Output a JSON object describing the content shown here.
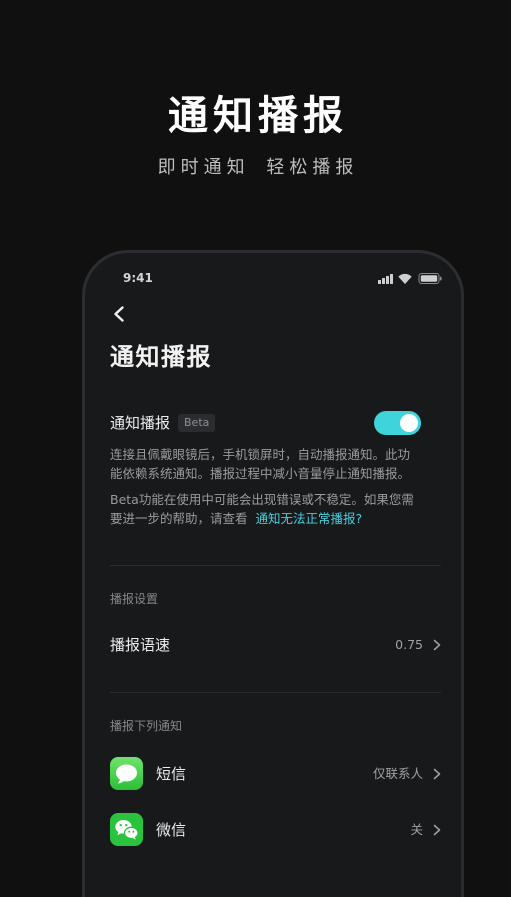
{
  "hero": {
    "title": "通知播报",
    "subtitle": "即时通知 轻松播报"
  },
  "status_bar": {
    "time": "9:41",
    "icons": [
      "cellular-signal-icon",
      "wifi-icon",
      "battery-icon"
    ]
  },
  "screen": {
    "back_icon": "chevron-left-icon",
    "title": "通知播报",
    "feature": {
      "label": "通知播报",
      "badge": "Beta",
      "enabled": true,
      "description": "连接且佩戴眼镜后，手机锁屏时，自动播报通知。此功能依赖系统通知。播报过程中减小音量停止通知播报。",
      "note": "Beta功能在使用中可能会出现错误或不稳定。如果您需要进一步的帮助，请查看",
      "help_link": "通知无法正常播报?"
    },
    "sections": [
      {
        "header": "播报设置",
        "items": [
          {
            "label": "播报语速",
            "value": "0.75",
            "icon": "chevron-right-icon"
          }
        ]
      },
      {
        "header": "播报下列通知",
        "items": [
          {
            "label": "短信",
            "value": "仅联系人",
            "icon": "messages-app-icon"
          },
          {
            "label": "微信",
            "value": "关",
            "icon": "wechat-app-icon"
          }
        ]
      }
    ]
  },
  "colors": {
    "background": "#101011",
    "screen": "#18191b",
    "accent": "#3fd4dc",
    "link": "#46cfdc",
    "messages_green": "#2bbf35",
    "wechat_green": "#2ac33e"
  }
}
